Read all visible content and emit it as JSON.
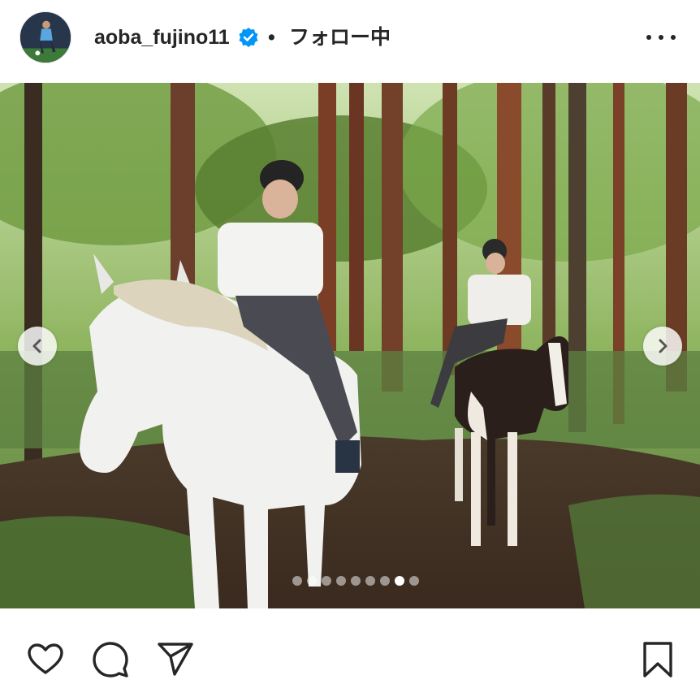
{
  "header": {
    "username": "aoba_fujino11",
    "separator": "•",
    "follow_status": "フォロー中",
    "verified_icon": "verified-badge-icon",
    "more_icon": "more-options-icon",
    "verified_color": "#0095f6"
  },
  "carousel": {
    "total_slides": 9,
    "active_slide": 8,
    "prev_icon": "chevron-left-icon",
    "next_icon": "chevron-right-icon"
  },
  "actions": {
    "icons": [
      "heart-icon",
      "comment-icon",
      "share-icon",
      "bookmark-icon"
    ]
  },
  "colors": {
    "text": "#262626",
    "verified": "#0095f6"
  }
}
